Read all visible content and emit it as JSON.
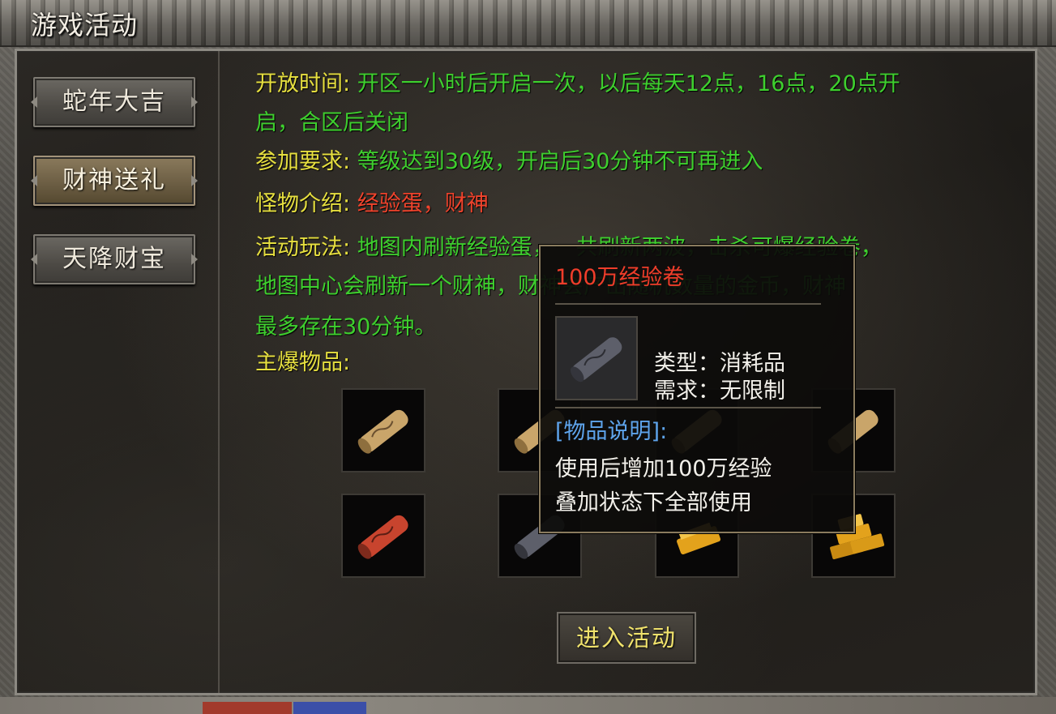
{
  "window": {
    "title": "游戏活动"
  },
  "sidebar": {
    "items": [
      {
        "label": "蛇年大吉",
        "active": false
      },
      {
        "label": "财神送礼",
        "active": true
      },
      {
        "label": "天降财宝",
        "active": false
      }
    ]
  },
  "info": {
    "open_time_label": "开放时间:",
    "open_time_value_1": "开区一小时后开启一次，以后每天12点，16点，20点开",
    "open_time_value_2": "启，合区后关闭",
    "requirement_label": "参加要求:",
    "requirement_value": "等级达到30级，开启后30分钟不可再进入",
    "monster_label": "怪物介绍:",
    "monster_value": "经验蛋，财神",
    "gameplay_label": "活动玩法:",
    "gameplay_value_1": "地图内刷新经验蛋，一共刷新两波，击杀可爆经验卷，",
    "gameplay_value_2": "地图中心会刷新一个财神，财神会产出随机数量的金币，财神",
    "gameplay_value_3": "最多存在30分钟。",
    "drops_label": "主爆物品:"
  },
  "drops": [
    {
      "icon": "beige-scroll-icon",
      "color": "#c9a56a"
    },
    {
      "icon": "beige-scroll-icon",
      "color": "#c9a56a"
    },
    {
      "icon": "beige-scroll-icon",
      "color": "#c9a56a"
    },
    {
      "icon": "beige-scroll-icon",
      "color": "#c9a56a"
    },
    {
      "icon": "red-scroll-icon",
      "color": "#c8442e"
    },
    {
      "icon": "gray-scroll-icon",
      "color": "#5d5f6a"
    },
    {
      "icon": "gold-bar-icon",
      "color": "#e3a21c"
    },
    {
      "icon": "gold-bars-stack-icon",
      "color": "#e3a21c"
    }
  ],
  "enter_button": {
    "label": "进入活动"
  },
  "tooltip": {
    "title": "100万经验卷",
    "type_line": "类型：消耗品",
    "requirement_line": "需求：无限制",
    "desc_header": "[物品说明]:",
    "desc_line_1": "使用后增加100万经验",
    "desc_line_2": "叠加状态下全部使用"
  },
  "colors": {
    "label_yellow": "#e6df3f",
    "value_green": "#3ecf2e",
    "monster_red": "#f0432c",
    "tooltip_title_red": "#ef3d2a",
    "tooltip_desc_blue": "#5ea4ec"
  }
}
